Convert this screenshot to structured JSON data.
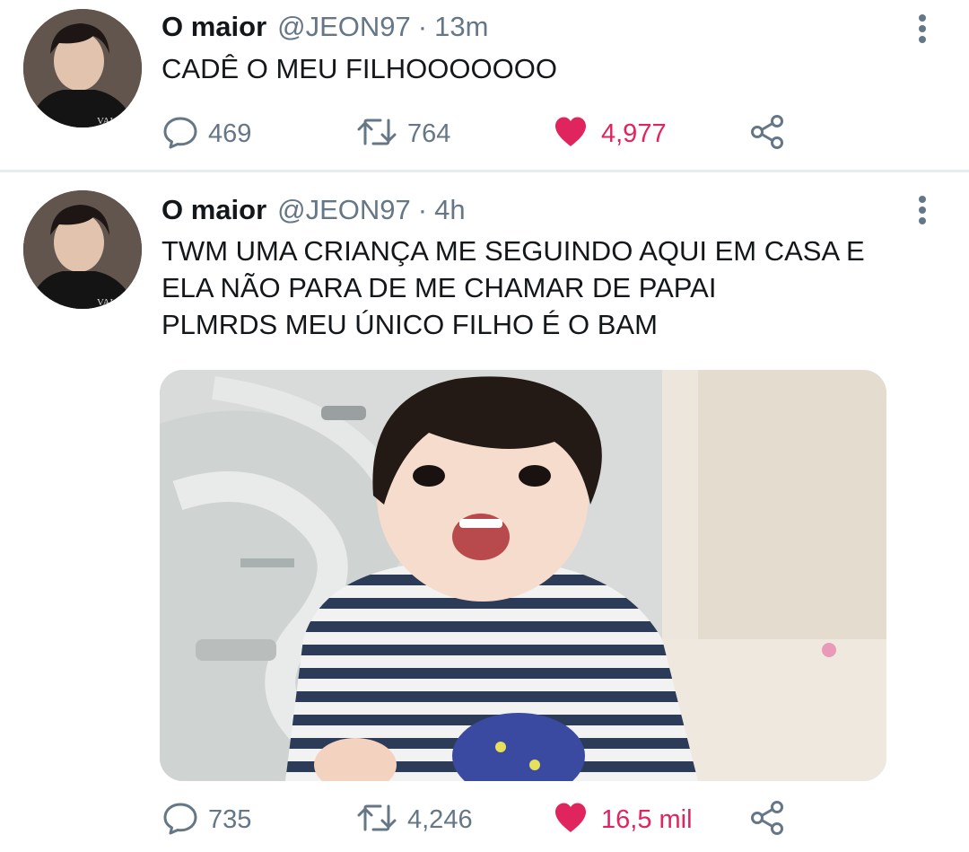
{
  "tweets": [
    {
      "name": "O maior",
      "handle": "@JEON97",
      "separator": "·",
      "time": "13m",
      "text": "CADÊ O MEU FILHOOOOOOO",
      "replies": "469",
      "retweets": "764",
      "likes": "4,977",
      "liked": true
    },
    {
      "name": "O maior",
      "handle": "@JEON97",
      "separator": "·",
      "time": "4h",
      "text": "TWM UMA CRIANÇA ME SEGUINDO AQUI EM CASA E\nELA NÃO PARA DE ME CHAMAR DE PAPAI\nPLMRDS MEU ÚNICO FILHO É O BAM",
      "has_media": true,
      "replies": "735",
      "retweets": "4,246",
      "likes": "16,5 mil",
      "liked": true
    }
  ],
  "icons": {
    "reply": "speech-bubble-icon",
    "retweet": "retweet-arrows-icon",
    "like": "heart-icon",
    "share": "share-nodes-icon",
    "menu": "vertical-ellipsis-icon"
  },
  "colors": {
    "text": "#14171a",
    "secondary": "#657786",
    "like": "#e0245e",
    "divider": "#e6ecf0"
  }
}
